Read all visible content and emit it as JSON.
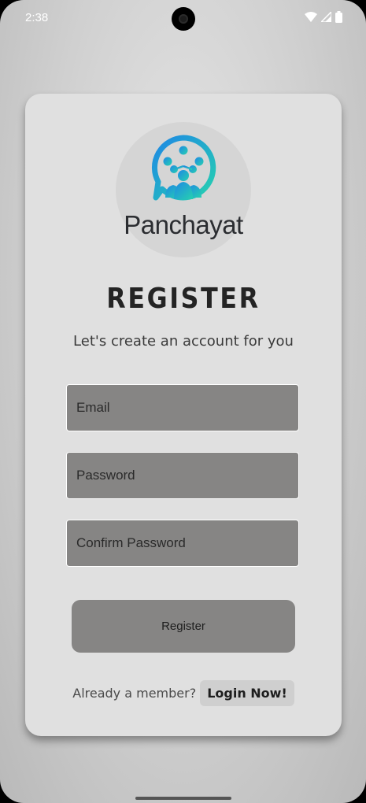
{
  "status_bar": {
    "time": "2:38",
    "icons": [
      "wifi-icon",
      "cellular-signal-icon",
      "battery-icon"
    ]
  },
  "logo": {
    "icon": "panchayat-chat-network-icon",
    "text": "Panchayat"
  },
  "title": "REGISTER",
  "subtitle": "Let's create an account for you",
  "form": {
    "email_placeholder": "Email",
    "password_placeholder": "Password",
    "confirm_placeholder": "Confirm Password",
    "email_value": "",
    "password_value": "",
    "confirm_value": ""
  },
  "register_button": "Register",
  "footer": {
    "prompt": "Already a member?",
    "login_link": "Login Now!"
  },
  "colors": {
    "card": "#e0e0e0",
    "field": "#868584",
    "button": "#868584",
    "logo_gradient_start": "#1e88e5",
    "logo_gradient_end": "#26d0b0"
  }
}
